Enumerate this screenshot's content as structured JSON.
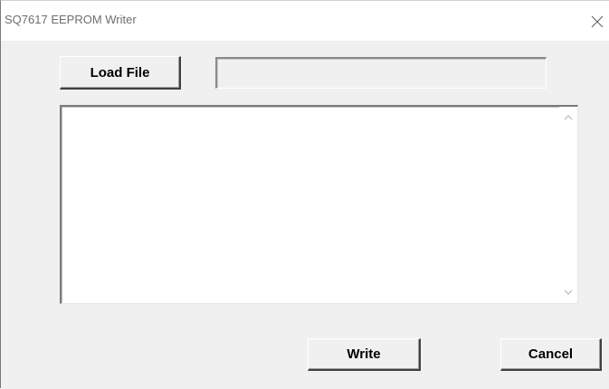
{
  "window": {
    "title": "SQ7617 EEPROM Writer",
    "close_icon": "close-icon"
  },
  "toolbar": {
    "load_label": "Load File",
    "file_path_value": ""
  },
  "editor": {
    "content": "",
    "scroll_up_icon": "chevron-up-icon",
    "scroll_down_icon": "chevron-down-icon"
  },
  "footer": {
    "write_label": "Write",
    "cancel_label": "Cancel"
  },
  "colors": {
    "dialog_background": "#f0f0f0",
    "titlebar_background": "#ffffff",
    "title_text": "#6d6d6d",
    "text_area_background": "#ffffff"
  }
}
